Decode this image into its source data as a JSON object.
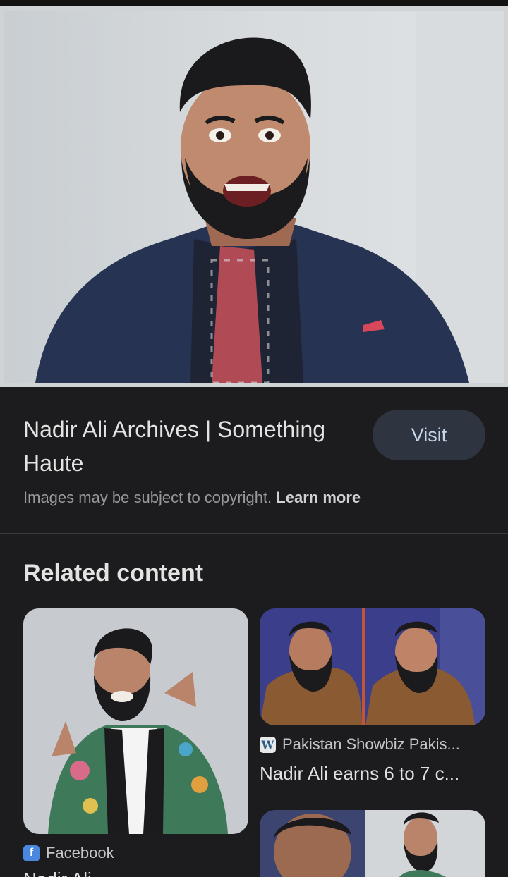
{
  "hero": {
    "alt": "Man with beard in dark suit and red checkered tie smiling"
  },
  "result": {
    "title": "Nadir Ali Archives | Something Haute",
    "visit_label": "Visit",
    "copyright_text": "Images may be subject to copyright.",
    "learn_more_label": "Learn more"
  },
  "related": {
    "heading": "Related content",
    "items": [
      {
        "source": "Facebook",
        "source_icon": "facebook-icon",
        "title": "Nadir Ali"
      },
      {
        "source": "Pakistan Showbiz Pakis...",
        "source_icon": "wordpress-icon",
        "title": "Nadir Ali earns 6 to 7 c..."
      }
    ]
  },
  "colors": {
    "background": "#1c1c1e",
    "visit_button": "#2e3440",
    "visit_text": "#c8d6ea"
  }
}
